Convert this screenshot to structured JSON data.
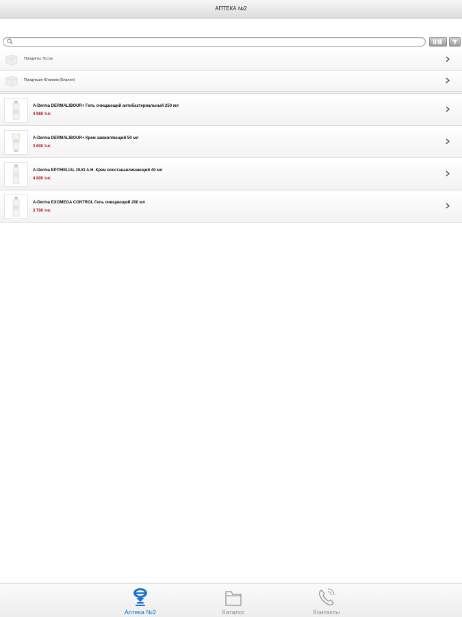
{
  "header": {
    "title": "АПТЕКА №2"
  },
  "search": {
    "placeholder": ""
  },
  "toolbar": {
    "barcode_icon": "barcode-icon",
    "filter_icon": "filter-icon"
  },
  "categories": [
    {
      "label": "Продукты Эссэа"
    },
    {
      "label": "Продукция Юнилим (Бизлин)"
    }
  ],
  "products": [
    {
      "name": "A-Derma DERMALIBOUR+ Гель очищающий антибактериальный 250 мл",
      "price": "4 960 тнг."
    },
    {
      "name": "A-Derma DERMALIBOUR+ Крем заживляющий 50 мл",
      "price": "3 600 тнг."
    },
    {
      "name": "A-Derma EPITHELIAL DUO A.H. Крем восстанавливающий 40 мл",
      "price": "4 800 тнг."
    },
    {
      "name": "A-Derma EXOMEGA CONTROL Гель очищающий 200 мл",
      "price": "3 700 тнг."
    }
  ],
  "tabs": [
    {
      "label": "Аптека №2",
      "icon": "pharmacy-logo-icon",
      "active": true
    },
    {
      "label": "Каталог",
      "icon": "folder-icon",
      "active": false
    },
    {
      "label": "Контакты",
      "icon": "phone-icon",
      "active": false
    }
  ],
  "colors": {
    "accent": "#1a73c8",
    "price": "#b01515"
  }
}
